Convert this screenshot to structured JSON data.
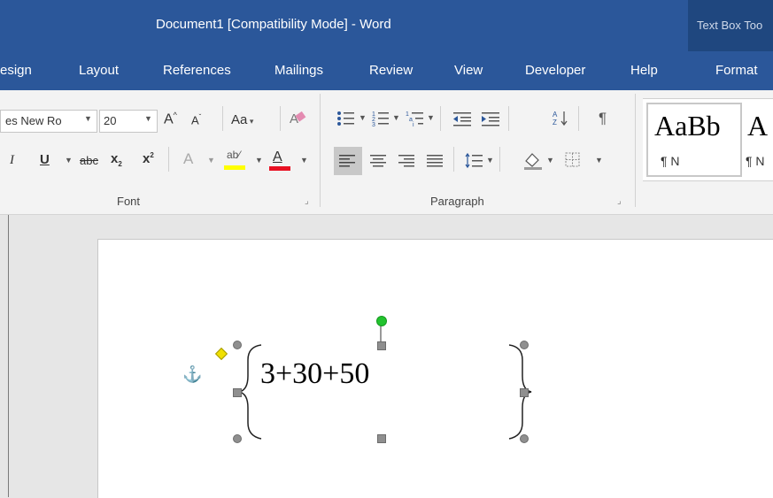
{
  "window": {
    "title": "Document1 [Compatibility Mode]  -  Word",
    "contextual_tab_title": "Text Box Too"
  },
  "tabs": [
    "esign",
    "Layout",
    "References",
    "Mailings",
    "Review",
    "View",
    "Developer",
    "Help",
    "Format"
  ],
  "font_group": {
    "font_name": "es New Ro",
    "font_size": "20",
    "change_case_label": "Aa",
    "strikethrough_label": "abc",
    "subscript_label": "x",
    "superscript_label": "x",
    "label": "Font"
  },
  "paragraph_group": {
    "label": "Paragraph"
  },
  "styles": [
    {
      "preview": "AaBb",
      "name": "¶ Normal"
    },
    {
      "preview": "A",
      "name": "¶ N"
    }
  ],
  "document": {
    "equation_text": "3+30+50"
  },
  "colors": {
    "title_bar": "#2b579a",
    "contextual_tab": "#1f477f",
    "highlight": "#ffff00",
    "font_color": "#e81123",
    "rotation_handle": "#22c32e",
    "adjust_handle": "#f0e000",
    "anchor": "#2f74c0"
  }
}
